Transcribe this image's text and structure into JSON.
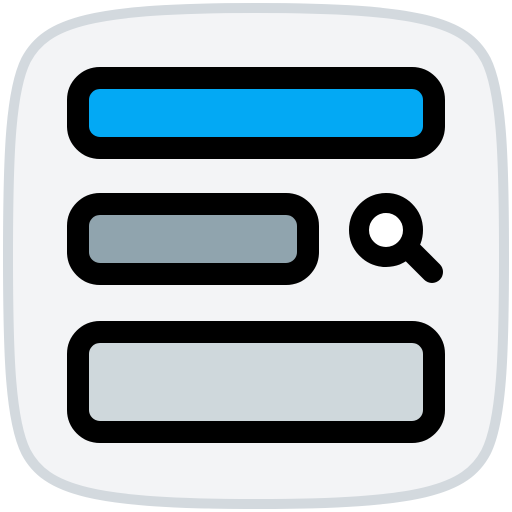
{
  "icon": {
    "name": "search-form-layout-icon",
    "colors": {
      "tile_fill": "#f3f4f6",
      "tile_border": "#d3d9de",
      "outline": "#000000",
      "header_bar": "#03a9f4",
      "search_input": "#90a4ae",
      "content_block": "#cfd8dc",
      "lens_fill": "#ffffff"
    }
  }
}
